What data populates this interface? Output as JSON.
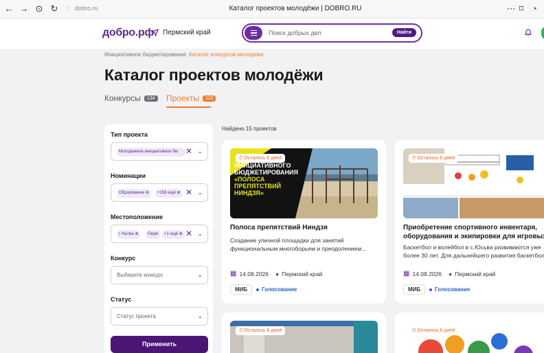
{
  "browser": {
    "url": "dobro.ru",
    "title": "Каталог проектов молодёжи | DOBRO.RU"
  },
  "header": {
    "logo": "добро.рф",
    "region": "Пермский край",
    "search_placeholder": "Поиск добрых дел",
    "search_button": "Найти"
  },
  "breadcrumb": {
    "items": [
      "Инициативное бюджетирование",
      "Каталог конкурсов молодежи"
    ],
    "separator": "/"
  },
  "page_title": "Каталог проектов молодёжи",
  "tabs": [
    {
      "label": "Конкурсы",
      "count": "134",
      "active": false
    },
    {
      "label": "Проекты",
      "count": "110",
      "active": true
    }
  ],
  "filters": {
    "project_type": {
      "label": "Тип проекта",
      "chip": "Молодежное инициативное бю"
    },
    "nominations": {
      "label": "Номинации",
      "chips": [
        "Образование",
        "+158 ещё"
      ]
    },
    "location": {
      "label": "Местоположение",
      "chips": [
        "г Нытва",
        "Перм",
        "+1 ещё"
      ]
    },
    "contest": {
      "label": "Конкурс",
      "placeholder": "Выберите конкурс"
    },
    "status": {
      "label": "Статус",
      "placeholder": "Статус проекта"
    },
    "apply": "Применить"
  },
  "results": {
    "found": "Найдено 15 проектов",
    "cards": [
      {
        "badge": "Осталось 6 дней",
        "title": "Полоса препятствий Ниндзя",
        "desc": "Создание уличной площадки для занятий функциональным многоборьем и преодолением...",
        "date": "14.08.2026",
        "region": "Пермский край",
        "tag": "МИБ",
        "status": "Голосование",
        "img_text": [
          "ИНИЦИАТИВНОГО",
          "БЮДЖЕТИРОВАНИЯ",
          "«ПОЛОСА",
          "ПРЕПЯТСТВИЙ",
          "НИНДЗЯ»"
        ]
      },
      {
        "badge": "Осталось 6 дней",
        "title": "Приобретение спортивного инвентаря, оборудования и экипировки для игровых...",
        "desc": "Баскетбол и волейбол в с.Юсьва развиваются уже более 30 лет. Для дальнейшего развития баскетбола...",
        "date": "14.08.2026",
        "region": "Пермский край",
        "tag": "МИБ",
        "status": "Голосование"
      },
      {
        "badge": "Осталось 6 дней"
      },
      {
        "badge": "Осталось 6 дней"
      }
    ]
  },
  "colors": {
    "brand": "#5b2c8f",
    "accent": "#ee7d30",
    "button": "#4b1575",
    "link": "#2a62c9"
  }
}
